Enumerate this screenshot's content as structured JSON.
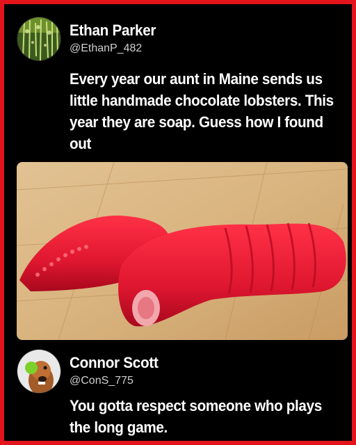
{
  "posts": [
    {
      "display_name": "Ethan Parker",
      "handle": "@EthanP_482",
      "text": "Every year our aunt in Maine sends us little handmade chocolate lobsters. This year they are soap. Guess how I found out"
    },
    {
      "display_name": "Connor Scott",
      "handle": "@ConS_775",
      "text": "You gotta respect someone who plays the long game."
    }
  ],
  "colors": {
    "border": "#e3141b",
    "background": "#000000",
    "text": "#ffffff",
    "handle": "#cfcfcf"
  }
}
